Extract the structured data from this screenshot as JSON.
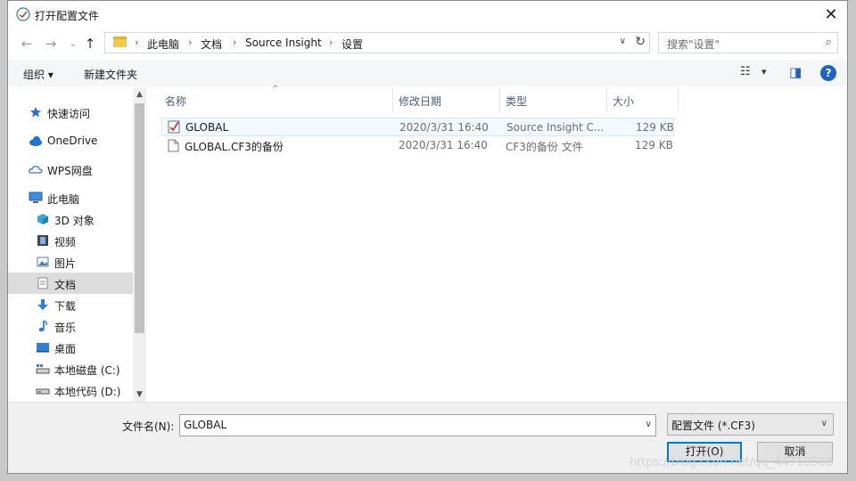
{
  "window": {
    "title": "打开配置文件",
    "close_glyph": "✕"
  },
  "nav": {
    "back": "←",
    "forward": "→",
    "recent": "⌄",
    "up": "↑"
  },
  "address": {
    "crumbs": [
      "此电脑",
      "文档",
      "Source Insight",
      "设置"
    ],
    "separator": "›",
    "dropdown": "∨",
    "refresh": "↻"
  },
  "search": {
    "placeholder": "搜索\"设置\"",
    "icon": "⌕"
  },
  "toolbar": {
    "organize": "组织 ▾",
    "new_folder": "新建文件夹",
    "view_icon": "☷",
    "view_dd": "▾",
    "preview_icon": "◨",
    "help": "?"
  },
  "sidebar": {
    "items": [
      {
        "label": "快速访问",
        "icon": "star-icon",
        "color": "#2e6fd0"
      },
      {
        "label": "OneDrive",
        "icon": "cloud-icon",
        "color": "#1e73d8"
      },
      {
        "label": "WPS网盘",
        "icon": "cloud-outline-icon",
        "color": "#3a78d8"
      },
      {
        "label": "此电脑",
        "icon": "computer-icon",
        "color": "#3d8ee0"
      },
      {
        "label": "3D 对象",
        "icon": "cube-icon",
        "color": "#38a6d9"
      },
      {
        "label": "视频",
        "icon": "film-icon",
        "color": "#444444"
      },
      {
        "label": "图片",
        "icon": "picture-icon",
        "color": "#5a7fa6"
      },
      {
        "label": "文档",
        "icon": "document-icon",
        "color": "#8a8a8a",
        "selected": true
      },
      {
        "label": "下载",
        "icon": "download-arrow-icon",
        "color": "#2f7fd6"
      },
      {
        "label": "音乐",
        "icon": "music-note-icon",
        "color": "#2f7fd6"
      },
      {
        "label": "桌面",
        "icon": "desktop-icon",
        "color": "#2f7fd6"
      },
      {
        "label": "本地磁盘 (C:)",
        "icon": "drive-c-icon",
        "color": "#555555"
      },
      {
        "label": "本地代码 (D:)",
        "icon": "drive-icon",
        "color": "#555555"
      }
    ]
  },
  "scroll": {
    "up": "▲",
    "down": "▼"
  },
  "columns": {
    "name": "名称",
    "modified": "修改日期",
    "type": "类型",
    "size": "大小",
    "sort_arrow": "^"
  },
  "files": [
    {
      "name": "GLOBAL",
      "modified": "2020/3/31 16:40",
      "type": "Source Insight C...",
      "size": "129 KB",
      "icon": "source-insight-icon"
    },
    {
      "name": "GLOBAL.CF3的备份",
      "modified": "2020/3/31 16:40",
      "type": "CF3的备份 文件",
      "size": "129 KB",
      "icon": "blank-file-icon"
    }
  ],
  "bottom": {
    "filename_label": "文件名(N):",
    "filename_value": "GLOBAL",
    "filename_dd": "∨",
    "filter_value": "配置文件 (*.CF3)",
    "filter_dd": "∨",
    "open_label": "打开(O)",
    "cancel_label": "取消"
  },
  "watermark": "https://blog.csdn.net/qq_44710568"
}
